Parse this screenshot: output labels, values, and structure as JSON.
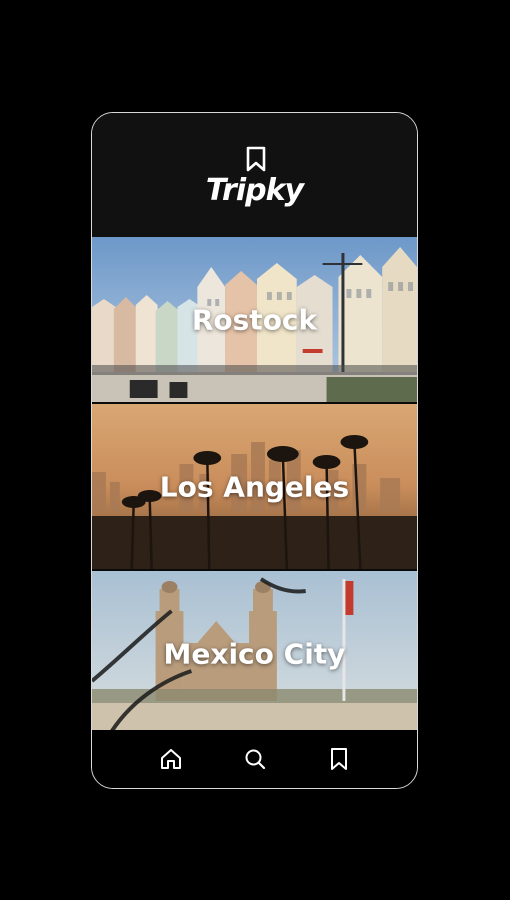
{
  "app": {
    "brand_name": "Tripky",
    "logo_icon": "bookmark-icon"
  },
  "destinations": [
    {
      "name": "Rostock"
    },
    {
      "name": "Los Angeles"
    },
    {
      "name": "Mexico City"
    }
  ],
  "bottom_nav": [
    {
      "icon": "home-icon"
    },
    {
      "icon": "search-icon"
    },
    {
      "icon": "bookmark-icon"
    }
  ],
  "colors": {
    "background": "#000000",
    "header": "#111111",
    "text": "#ffffff",
    "frame_border": "#d9d9d9"
  }
}
